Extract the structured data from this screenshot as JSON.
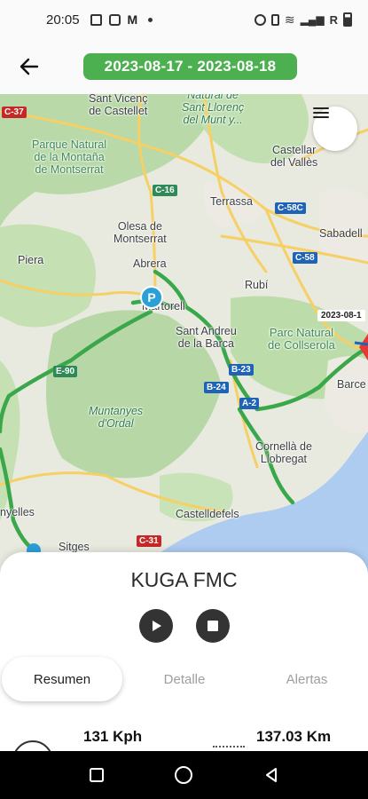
{
  "status_bar": {
    "time": "20:05",
    "network_label": "R",
    "icons": [
      "image-icon",
      "cast-icon",
      "gmail-icon",
      "alarm-icon",
      "vibrate-icon",
      "wifi-icon",
      "signal-icon",
      "battery-icon"
    ]
  },
  "header": {
    "date_range": "2023-08-17 - 2023-08-18",
    "back_icon": "arrow-left-icon",
    "accent_color": "#4caf50"
  },
  "map": {
    "menu_icon": "menu-icon",
    "date_tag": "2023-08-1",
    "parking_marker": "P",
    "places": {
      "sant_vicenc": "Sant Vicenç\nde Castellet",
      "natural_sant": "Natural de\nSant Llorenç\ndel Munt y...",
      "castellar": "Castellar\ndel Vallès",
      "parque_montserrat": "Parque Natural\nde la Montaña\nde Montserrat",
      "terrassa": "Terrassa",
      "sabadell": "Sabadell",
      "olesa": "Olesa de\nMontserrat",
      "abrera": "Abrera",
      "piera": "Piera",
      "rubi": "Rubí",
      "martorell": "Martorell",
      "sant_andreu": "Sant Andreu\nde la Barca",
      "parc_collserola": "Parc Natural\nde Collserola",
      "barcelona": "Barce",
      "muntanyes": "Muntanyes\nd'Ordal",
      "cornella": "Cornellà de\nLlobregat",
      "castelldefels": "Castelldefels",
      "vilanova": "nyelles",
      "sitges": "Sitges"
    },
    "roads": {
      "c37": "C-37",
      "c16": "C-16",
      "c58c": "C-58C",
      "c58": "C-58",
      "e90": "E-90",
      "b23": "B-23",
      "b24": "B-24",
      "a2": "A-2",
      "c31": "C-31"
    }
  },
  "sheet": {
    "vehicle_name": "KUGA FMC",
    "play_icon": "play-icon",
    "stop_icon": "stop-icon",
    "tabs": [
      {
        "label": "Resumen",
        "active": true
      },
      {
        "label": "Detalle",
        "active": false
      },
      {
        "label": "Alertas",
        "active": false
      }
    ],
    "stats": {
      "speed": "131 Kph",
      "distance": "137.03 Km"
    }
  },
  "nav": {
    "icons": [
      "recents-icon",
      "home-icon",
      "back-icon"
    ]
  }
}
